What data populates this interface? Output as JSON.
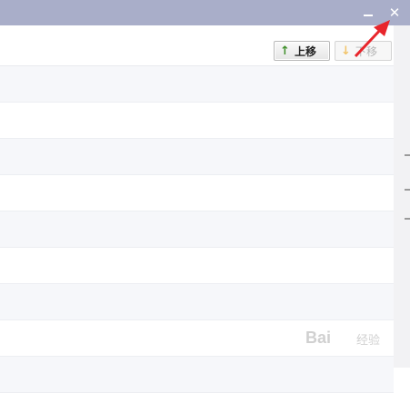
{
  "window": {
    "minimize_label": "–",
    "close_label": "✕"
  },
  "toolbar": {
    "move_up_label": "上移",
    "move_up_icon": "↑",
    "move_down_label": "下移",
    "move_down_icon": "↓"
  },
  "list": {
    "rows": [
      "",
      "",
      "",
      "",
      "",
      "",
      "",
      "",
      ""
    ]
  },
  "watermark": {
    "brand": "Bai",
    "suffix": "经验"
  },
  "colors": {
    "titlebar": "#a9aec9",
    "row_alt": "#f6f7fa",
    "annotation_arrow": "#e8252b"
  }
}
